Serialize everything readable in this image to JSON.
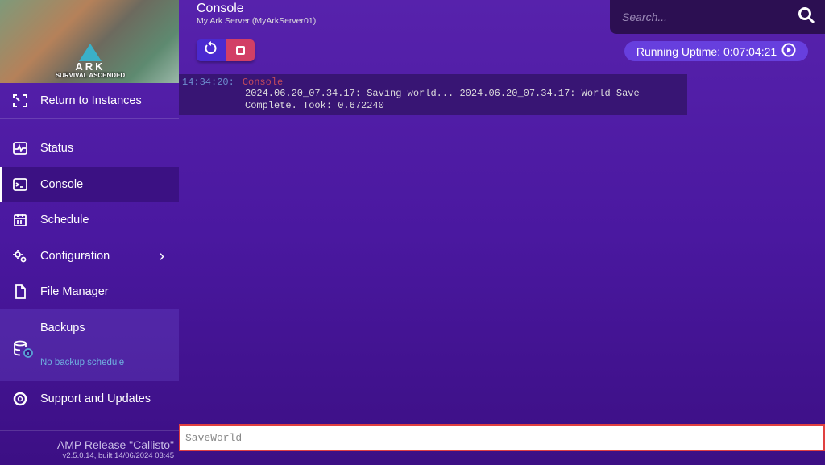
{
  "banner": {
    "logo_text": "ARK",
    "logo_sub": "SURVIVAL ASCENDED"
  },
  "sidebar": {
    "return": "Return to Instances",
    "items": [
      {
        "label": "Status"
      },
      {
        "label": "Console"
      },
      {
        "label": "Schedule"
      },
      {
        "label": "Configuration"
      },
      {
        "label": "File Manager"
      },
      {
        "label": "Backups",
        "sub": "No backup schedule"
      },
      {
        "label": "Support and Updates"
      }
    ]
  },
  "footer": {
    "release": "AMP Release \"Callisto\"",
    "build": "v2.5.0.14, built 14/06/2024 03:45"
  },
  "header": {
    "title": "Console",
    "subtitle": "My Ark Server (MyArkServer01)"
  },
  "search": {
    "placeholder": "Search..."
  },
  "uptime": "Running Uptime: 0:07:04:21",
  "console": {
    "time": "14:34:20:",
    "source": "Console",
    "message": "2024.06.20_07.34.17: Saving world... 2024.06.20_07.34.17: World Save Complete. Took: 0.672240"
  },
  "command": {
    "value": "SaveWorld"
  },
  "colors": {
    "restart": "#4a2ad0",
    "stop": "#d23f66",
    "accent": "#673fde"
  }
}
